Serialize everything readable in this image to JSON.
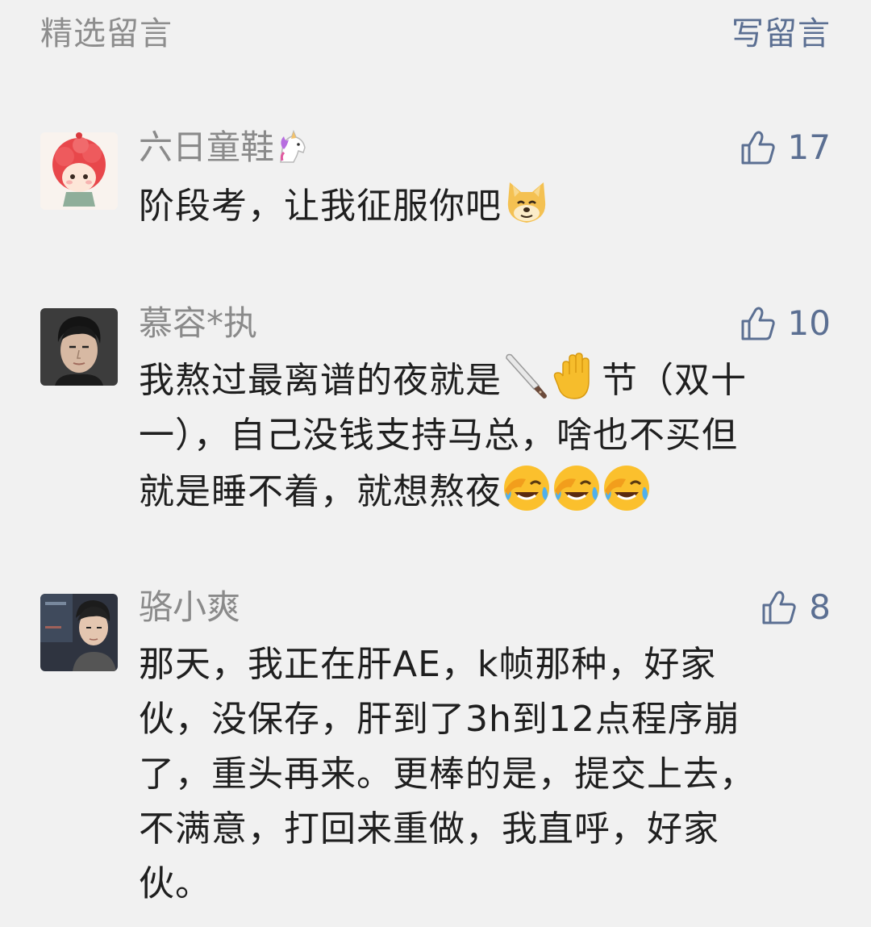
{
  "header": {
    "title": "精选留言",
    "action": "写留言"
  },
  "comments": [
    {
      "name": "六日童鞋",
      "likes": "17",
      "lines": [
        "阶段考，让我征服你吧"
      ]
    },
    {
      "name": "慕容*执",
      "likes": "10",
      "lines": [
        "我熬过最离谱的夜就是",
        "节（双十",
        "一），自己没钱支持马总，啥也不买但",
        "就是睡不着，就想熬夜"
      ]
    },
    {
      "name": "骆小爽",
      "likes": "8",
      "lines": [
        "那天，我正在肝AE，k帧那种，好家",
        "伙，没保存，肝到了3h到12点程序崩",
        "了，重头再来。更棒的是，提交上去，",
        "不满意，打回来重做，我直呼，好家",
        "伙。"
      ]
    }
  ],
  "colors": {
    "background": "#f1f1f1",
    "link": "#5b6f92",
    "nickname": "#8a8a8a",
    "text": "#1f1f1f"
  },
  "icons": [
    "thumbs-up-icon",
    "unicorn-emoji",
    "doge-emoji",
    "knife-emoji",
    "hand-emoji",
    "laugh-cry-emoji"
  ]
}
